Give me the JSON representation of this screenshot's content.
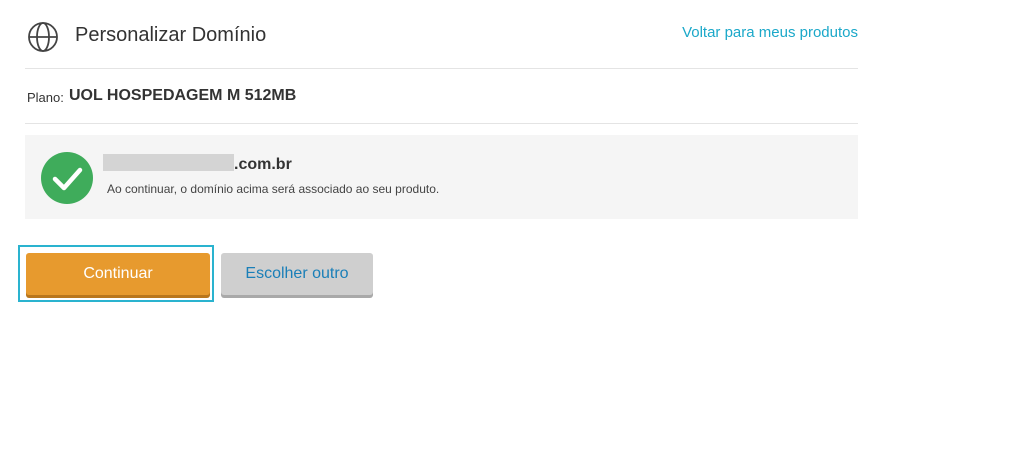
{
  "header": {
    "title": "Personalizar Domínio",
    "back_link": "Voltar para meus produtos",
    "icon": "globe-icon"
  },
  "plan": {
    "label": "Plano:",
    "value": "UOL HOSPEDAGEM M 512MB"
  },
  "domain_panel": {
    "icon": "check-circle-icon",
    "domain_suffix": ".com.br",
    "notice": "Ao continuar, o domínio acima será associado ao seu produto.",
    "success_color": "#3fac5b"
  },
  "actions": {
    "continue_label": "Continuar",
    "choose_other_label": "Escolher outro",
    "primary_color": "#e79a2e",
    "focus_color": "#2ab3cf"
  }
}
